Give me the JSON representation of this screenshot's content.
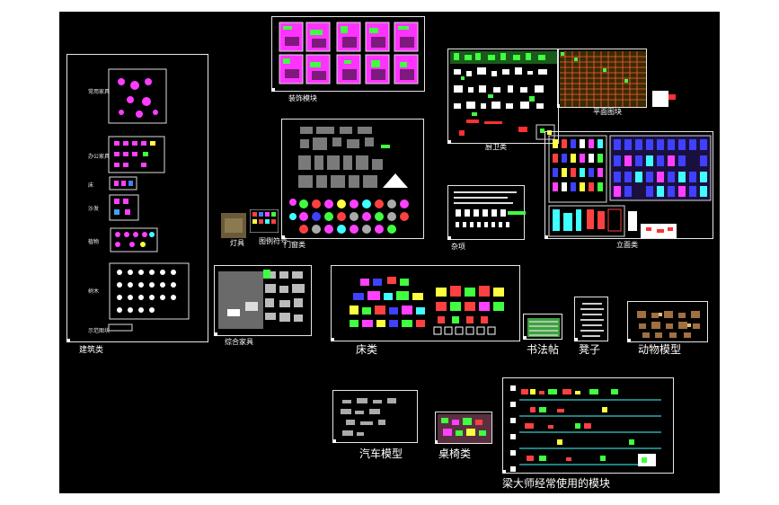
{
  "viewport": {
    "background": "#000000",
    "frame_color": "#e6e6e6"
  },
  "blocks": {
    "architecture": {
      "label": "建筑类",
      "side_labels": [
        "常用家具",
        "办公家具",
        "床",
        "沙发",
        "植物",
        "树木",
        "示范图块"
      ]
    },
    "decoration": {
      "label": "装饰模块"
    },
    "bathroom": {
      "label": "厨卫类"
    },
    "plan": {
      "label": "平面图块"
    },
    "elevation": {
      "label": "立面类"
    },
    "doors": {
      "label": "门窗类"
    },
    "lighting": {
      "label": "灯具"
    },
    "symbols": {
      "label": "图例符号"
    },
    "misc": {
      "label": "杂项"
    },
    "furniture": {
      "label": "综合家具"
    },
    "beds": {
      "label": "床类"
    },
    "calligraphy": {
      "label": "书法帖"
    },
    "stool": {
      "label": "凳子"
    },
    "animals": {
      "label": "动物模型"
    },
    "cars": {
      "label": "汽车模型"
    },
    "tables": {
      "label": "桌椅类"
    },
    "master": {
      "label": "梁大师经常使用的模块"
    }
  }
}
